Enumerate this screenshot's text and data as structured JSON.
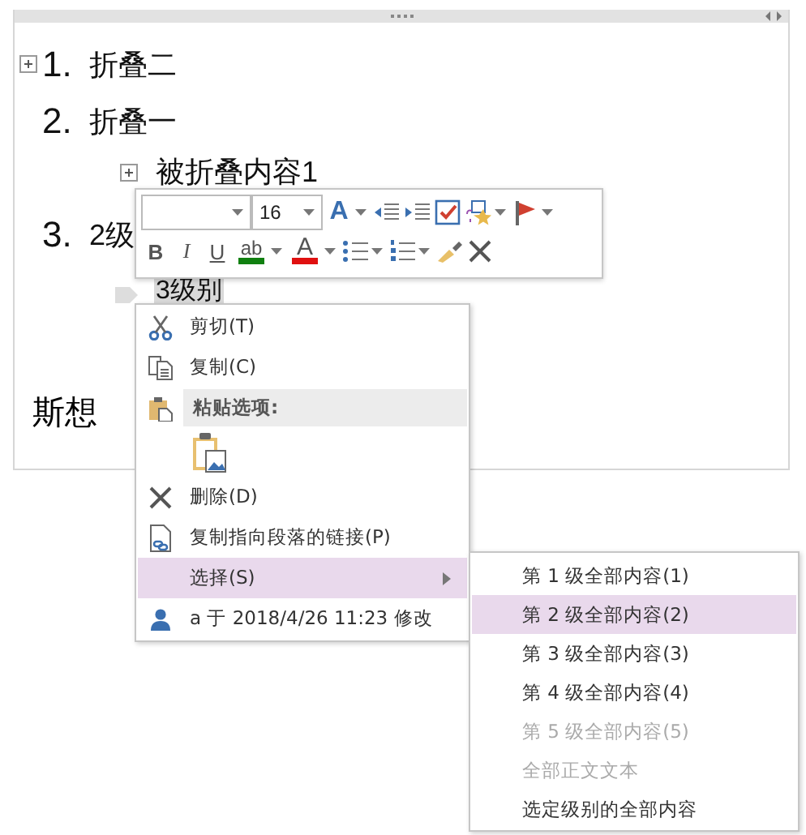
{
  "outline": [
    {
      "number": "1.",
      "text": "折叠二",
      "collapsed": true,
      "selected": false
    },
    {
      "number": "2.",
      "text": "折叠一",
      "selected": false,
      "children": [
        {
          "text": "被折叠内容1",
          "collapsed": true,
          "selected": false
        }
      ]
    },
    {
      "number": "3.",
      "text": "2级",
      "selected": false,
      "children": [
        {
          "text": "3级别",
          "selected": true
        }
      ]
    }
  ],
  "trailing_text": "斯想",
  "mini_toolbar": {
    "font_size": "16",
    "styles_label": "A",
    "format_buttons": [
      "B",
      "I",
      "U"
    ],
    "highlight_label": "ab",
    "font_color_label": "A"
  },
  "context_menu": {
    "items": [
      {
        "kind": "command",
        "label": "剪切(T)",
        "selected": false
      },
      {
        "kind": "command",
        "label": "复制(C)",
        "selected": false
      },
      {
        "kind": "header",
        "label": "粘贴选项:"
      },
      {
        "kind": "paste_option"
      },
      {
        "kind": "command",
        "label": "删除(D)",
        "selected": false
      },
      {
        "kind": "command",
        "label": "复制指向段落的链接(P)",
        "selected": false
      },
      {
        "kind": "submenu",
        "label": "选择(S)",
        "selected": true
      },
      {
        "kind": "command",
        "label": "a 于 2018/4/26 11:23 修改",
        "selected": false
      }
    ]
  },
  "submenu": {
    "items": [
      {
        "label": "第 1 级全部内容(1)",
        "selected": false,
        "disabled": false
      },
      {
        "label": "第 2 级全部内容(2)",
        "selected": true,
        "disabled": false
      },
      {
        "label": "第 3 级全部内容(3)",
        "selected": false,
        "disabled": false
      },
      {
        "label": "第 4 级全部内容(4)",
        "selected": false,
        "disabled": false
      },
      {
        "label": "第 5 级全部内容(5)",
        "selected": false,
        "disabled": true
      },
      {
        "label": "全部正文文本",
        "selected": false,
        "disabled": true
      },
      {
        "label": "选定级别的全部内容",
        "selected": false,
        "disabled": false
      }
    ]
  }
}
